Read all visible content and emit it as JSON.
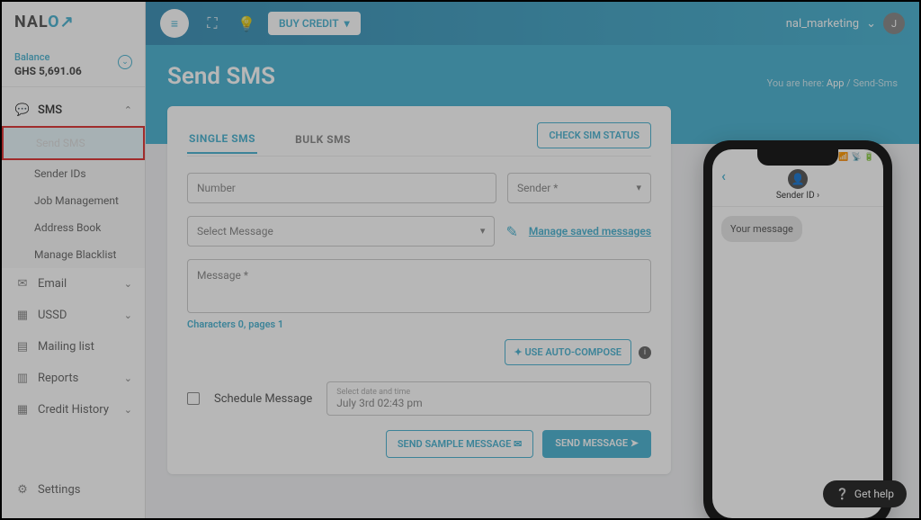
{
  "logo": {
    "part1": "NAL",
    "part2": "O"
  },
  "balance": {
    "label": "Balance",
    "sub": "",
    "amount": "GHS 5,691.06"
  },
  "nav": {
    "sms": "SMS",
    "sub": [
      "Send SMS",
      "Sender IDs",
      "Job Management",
      "Address Book",
      "Manage Blacklist"
    ],
    "email": "Email",
    "ussd": "USSD",
    "mailing": "Mailing list",
    "reports": "Reports",
    "credit": "Credit History",
    "settings": "Settings"
  },
  "header": {
    "buy": "BUY CREDIT",
    "user": "nal_marketing",
    "avatar": "J"
  },
  "page": {
    "title": "Send SMS"
  },
  "breadcrumb": {
    "prefix": "You are here:",
    "app": "App",
    "sep": "/",
    "current": "Send-Sms"
  },
  "tabs": {
    "single": "SINGLE SMS",
    "bulk": "BULK SMS",
    "check": "CHECK SIM STATUS"
  },
  "form": {
    "number": "Number",
    "sender": "Sender *",
    "selectMsg": "Select Message",
    "manage": "Manage saved messages",
    "message": "Message *",
    "chars_label": "Characters",
    "chars": "0",
    "pages_label": "pages",
    "pages": "1",
    "auto": "USE AUTO-COMPOSE",
    "schedule": "Schedule Message",
    "dateLabel": "Select date and time",
    "dateVal": "July 3rd 02:43 pm",
    "sample": "SEND SAMPLE MESSAGE",
    "send": "SEND MESSAGE"
  },
  "phone": {
    "sender": "Sender ID",
    "bubble": "Your message"
  },
  "help": "Get help"
}
